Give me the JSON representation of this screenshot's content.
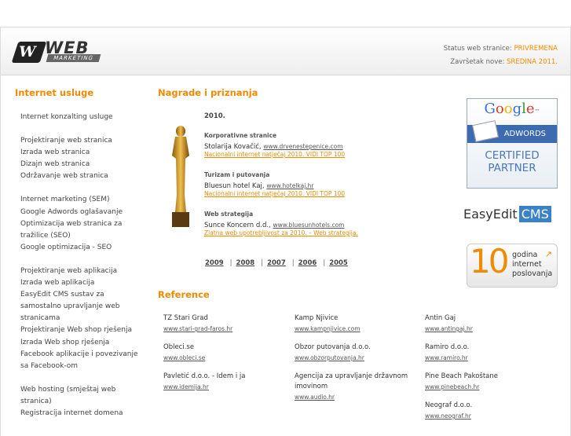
{
  "logo": {
    "mark": "W",
    "word": "WEB",
    "sub": "MARKETING"
  },
  "status": {
    "label1": "Status web stranice:",
    "value1": "PRIVREMENA",
    "label2": "Završetak nove:",
    "value2": "SREDINA 2011."
  },
  "nav": {
    "heading": "Internet usluge",
    "groups": [
      [
        "Internet konzalting usluge"
      ],
      [
        "Projektiranje web stranica",
        "Izrada web stranica",
        "Dizajn web stranica",
        "Održavanje web stranica"
      ],
      [
        "Internet marketing (SEM)",
        "Google Adwords oglašavanje",
        "Optimizacija web stranica za tražilice (SEO)",
        "Google optimizacija - SEO"
      ],
      [
        "Projektiranje web aplikacija",
        "Izrada web aplikacija",
        "EasyEdit CMS sustav za samostalno upravljanje web stranicama",
        "Projektiranje Web shop rješenja",
        "Izrada Web shop rješenja",
        "Facebook aplikacije i povezivanje sa Facebook-om"
      ],
      [
        "Web hosting (smještaj web stranica)",
        "Registracija internet domena"
      ]
    ]
  },
  "awards": {
    "heading": "Nagrade i priznanja",
    "year": "2010.",
    "items": [
      {
        "category": "Korporativne stranice",
        "winner": "Stolarija Kovačić,",
        "url": "www.drvenestepenice.com",
        "prize": "Nacionalni internet natječaj 2010. VIDI TOP 100"
      },
      {
        "category": "Turizam i putovanja",
        "winner": "Bluesun hotel Kaj,",
        "url": "www.hotelkaj.hr",
        "prize": "Nacionalni internet natječaj 2010. VIDI TOP 100"
      },
      {
        "category": "Web strategija",
        "winner": "Sunce Koncern d.d.,",
        "url": "www.bluesunhotels.com",
        "prize": "Zlatna web upotrebljivost za 2010. – Web strategija."
      }
    ],
    "years": [
      "2009",
      "2008",
      "2007",
      "2006",
      "2005"
    ]
  },
  "references": {
    "heading": "Reference",
    "items": [
      {
        "name": "TZ Stari Grad",
        "url": "www.stari-grad-faros.hr"
      },
      {
        "name": "Kamp Njivice",
        "url": "www.kampnjivice.com"
      },
      {
        "name": "Antin Gaj",
        "url": "www.antingaj.hr"
      },
      {
        "name": "Obleci.se",
        "url": "www.obleci.se"
      },
      {
        "name": "Obzor putovanja d.o.o.",
        "url": "www.obzorputovanja.hr"
      },
      {
        "name": "Ramiro d.o.o.",
        "url": "www.ramiro.hr"
      },
      {
        "name": "Pavletić d.o.o. - Idem i ja",
        "url": "www.idemija.hr"
      },
      {
        "name": "Agencija za upravljanje državnom imovinom",
        "url": "www.audio.hr"
      },
      {
        "name": "Pine Beach Pakoštane",
        "url": "www.pinebeach.hr"
      },
      {
        "name": "Neograf d.o.o.",
        "url": "www.neograf.hr"
      }
    ]
  },
  "badges": {
    "google": {
      "logo": "Google",
      "tm": "™",
      "bar": "ADWORDS",
      "cert1": "CERTIFIED",
      "cert2": "PARTNER"
    },
    "cms": {
      "word": "EasyEdit",
      "box": "CMS"
    },
    "years": {
      "number": "10",
      "line1": "godina",
      "line2": "internet",
      "line3": "poslovanja"
    }
  },
  "colors": {
    "accent": "#f08a00",
    "google_blue": "#3c6bb2",
    "cms_blue": "#3a82c8"
  }
}
